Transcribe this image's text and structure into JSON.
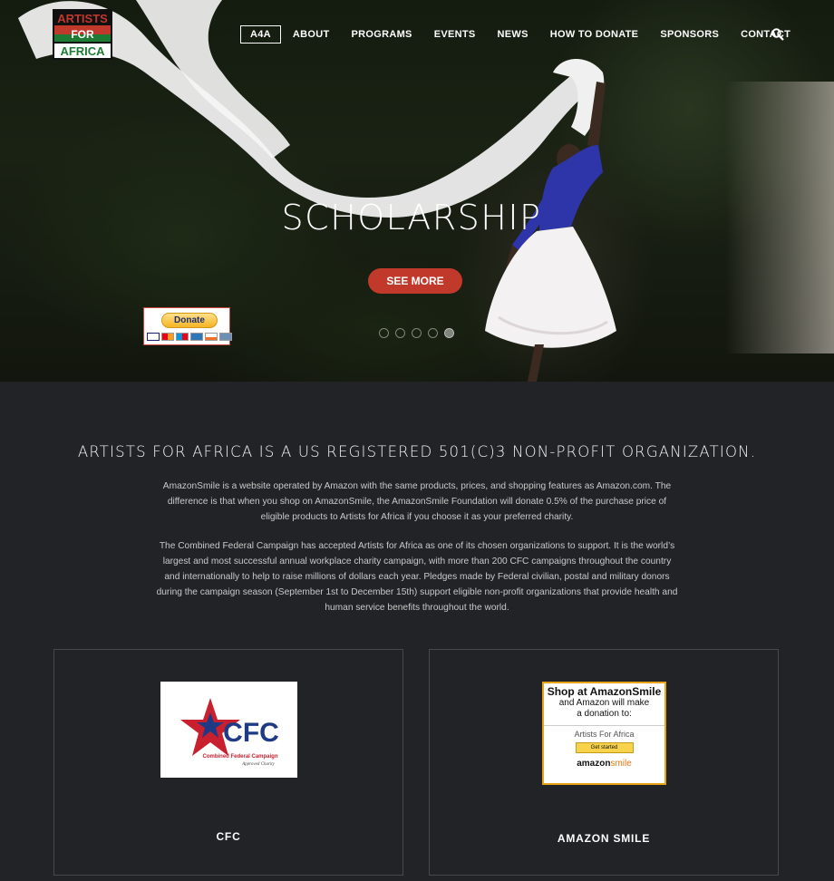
{
  "colors": {
    "accent": "#c0392b",
    "background": "#212326",
    "paypal_yellow": "#f5b423"
  },
  "logo": {
    "line1": "ARTISTS",
    "line2": "FOR",
    "line3": "AFRICA"
  },
  "nav": {
    "items": [
      "A4A",
      "ABOUT",
      "PROGRAMS",
      "EVENTS",
      "NEWS",
      "HOW TO DONATE",
      "SPONSORS",
      "CONTACT"
    ],
    "active": "A4A",
    "search_icon": "search-icon"
  },
  "hero": {
    "title": "SCHOLARSHIP",
    "cta": "SEE MORE",
    "slides": 5,
    "active_slide": 5
  },
  "donate": {
    "label": "Donate"
  },
  "intro": {
    "heading": "ARTISTS FOR AFRICA IS A US REGISTERED 501(C)3 NON-PROFIT ORGANIZATION.",
    "para1": "AmazonSmile is a website operated by Amazon with the same products, prices, and shopping features as Amazon.com. The difference is that when you shop on AmazonSmile, the AmazonSmile Foundation will donate 0.5% of the purchase price of eligible products to Artists for Africa if you choose it as your preferred charity.",
    "para2": "The Combined Federal Campaign has accepted Artists for Africa as one of its chosen organizations to support. It is the world’s largest and most successful annual workplace charity campaign, with more than 200 CFC campaigns throughout the country and internationally to help to raise millions of dollars each year. Pledges made by Federal civilian, postal and military donors during the campaign season (September 1st to December 15th) support eligible non-profit organizations that provide health and human service benefits throughout the world."
  },
  "cards": {
    "cfc": {
      "label": "CFC",
      "logo_text": "CFC",
      "logo_sub": "Combined Federal Campaign",
      "logo_sub2": "Approved Charity"
    },
    "amazon": {
      "label": "AMAZON SMILE",
      "line1": "Shop at AmazonSmile",
      "line2": "and Amazon will make",
      "line3": "a donation to:",
      "org": "Artists For Africa",
      "button": "Get started",
      "brand": "amazon",
      "brand2": "smile"
    }
  }
}
